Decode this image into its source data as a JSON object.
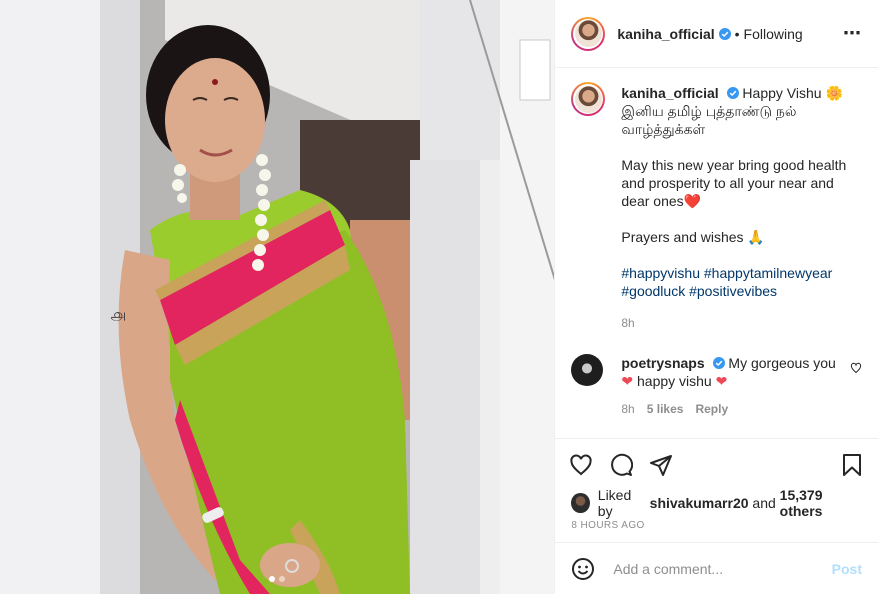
{
  "header": {
    "username": "kaniha_official",
    "separator": "•",
    "follow_status": "Following",
    "more_label": "..."
  },
  "caption": {
    "username": "kaniha_official",
    "line1": "Happy Vishu 🌼",
    "line2": "இனிய தமிழ் புத்தாண்டு நல் வாழ்த்துக்கள்",
    "line3": "May this new year bring good health and prosperity to all your near and dear ones❤️",
    "line4": "Prayers and wishes 🙏",
    "hashtags": [
      "#happyvishu",
      "#happytamilnewyear",
      "#goodluck",
      "#positivevibes"
    ],
    "time": "8h"
  },
  "reply": {
    "username": "poetrysnaps",
    "text_part1": "My gorgeous you",
    "heart": "❤",
    "text_part2": "happy vishu",
    "time": "8h",
    "likes": "5 likes",
    "reply_label": "Reply"
  },
  "likes": {
    "prefix": "Liked by",
    "user": "shivakumarr20",
    "conj": "and",
    "others": "15,379 others"
  },
  "timestamp": "8 HOURS AGO",
  "add_comment": {
    "placeholder": "Add a comment...",
    "post_label": "Post"
  },
  "carousel": {
    "count": 2,
    "active": 1
  },
  "colors": {
    "link": "#00376b",
    "verified": "#3897f0",
    "heart": "#ed4956",
    "post_disabled": "#b2dffc",
    "saree_green": "#8fbf24",
    "saree_pink": "#e2245f"
  },
  "icons": [
    "more-icon",
    "verified-icon",
    "heart-icon",
    "comment-icon",
    "share-icon",
    "bookmark-icon",
    "emoji-icon"
  ]
}
